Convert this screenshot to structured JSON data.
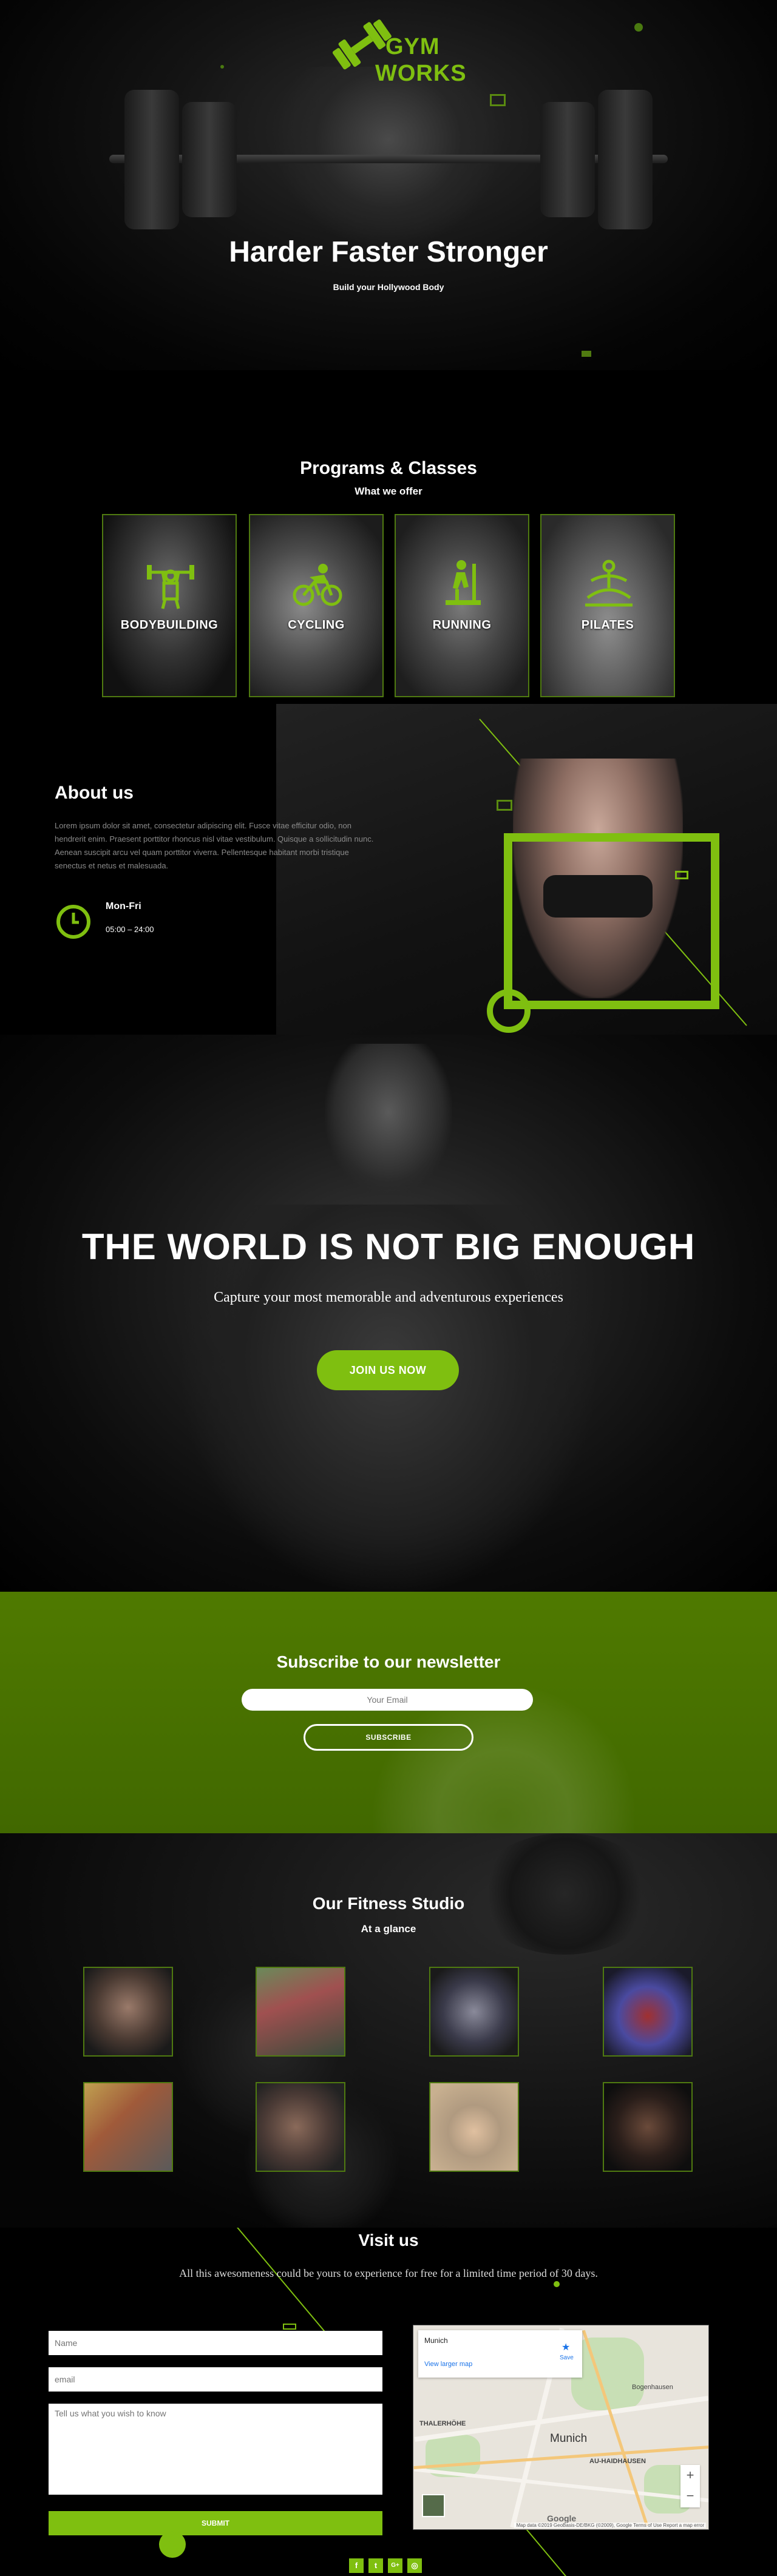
{
  "hero": {
    "logo_line1": "GYM",
    "logo_line2": "WORKS",
    "title": "Harder Faster Stronger",
    "subtitle": "Build your Hollywood Body"
  },
  "programs": {
    "title": "Programs & Classes",
    "subtitle": "What we offer",
    "items": [
      {
        "label": "BODYBUILDING",
        "icon": "weightlifter-icon"
      },
      {
        "label": "CYCLING",
        "icon": "cyclist-icon"
      },
      {
        "label": "RUNNING",
        "icon": "treadmill-icon"
      },
      {
        "label": "PILATES",
        "icon": "meditation-icon"
      }
    ]
  },
  "about": {
    "title": "About us",
    "text": "Lorem ipsum dolor sit amet, consectetur adipiscing elit. Fusce vitae efficitur odio, non hendrerit enim. Praesent porttitor rhoncus nisl vitae vestibulum. Quisque a sollicitudin nunc. Aenean suscipit arcu vel quam porttitor viverra. Pellentesque habitant morbi tristique senectus et netus et malesuada.",
    "days": "Mon-Fri",
    "hours": "05:00 – 24:00",
    "icon": "clock-icon"
  },
  "world": {
    "title": "THE WORLD IS NOT BIG ENOUGH",
    "subtitle": "Capture your most memorable and adventurous experiences",
    "cta": "JOIN US NOW"
  },
  "subscribe": {
    "title": "Subscribe to our newsletter",
    "email_placeholder": "Your Email",
    "button": "SUBSCRIBE"
  },
  "studio": {
    "title": "Our Fitness Studio",
    "subtitle": "At a glance"
  },
  "visit": {
    "title": "Visit us",
    "subtitle": "All this awesomeness could be yours to experience for free for a limited time period of 30 days.",
    "name_placeholder": "Name",
    "email_placeholder": "email",
    "message_placeholder": "Tell us what you wish to know",
    "submit": "SUBMIT",
    "map": {
      "city": "Munich",
      "larger_link": "View larger map",
      "save": "Save",
      "city_label": "Munich",
      "labels": [
        "THALERHÖHE",
        "AU-HAIDHAUSEN",
        "Bogenhausen"
      ],
      "attribution": "Map data ©2019 GeoBasis-DE/BKG (©2009), Google  Terms of Use  Report a map error",
      "google": "Google",
      "zoom_in": "+",
      "zoom_out": "−"
    },
    "social": [
      "f",
      "t",
      "G+",
      "◎"
    ]
  },
  "colors": {
    "accent": "#7fbf10",
    "subscribe_bg": "#4f7a00"
  }
}
